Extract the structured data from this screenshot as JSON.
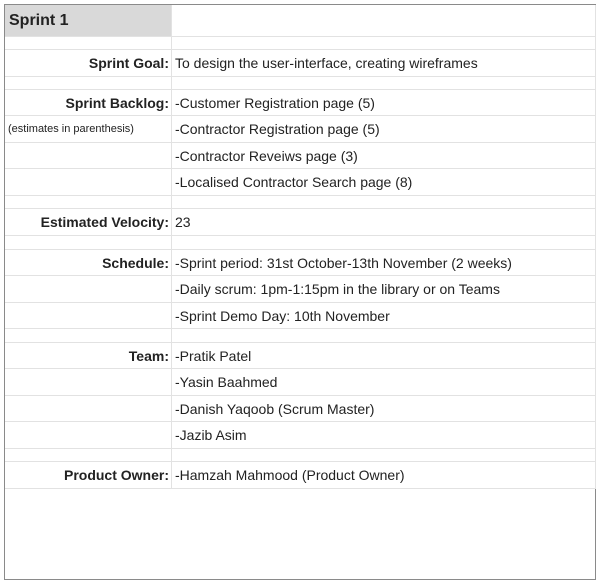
{
  "title": "Sprint 1",
  "sprint_goal": {
    "label": "Sprint Goal:",
    "value": "To design the user-interface, creating wireframes"
  },
  "sprint_backlog": {
    "label": "Sprint Backlog:",
    "note": "(estimates in parenthesis)",
    "items": [
      "-Customer Registration page (5)",
      "-Contractor Registration page (5)",
      "-Contractor Reveiws page (3)",
      "-Localised Contractor Search page (8)"
    ]
  },
  "estimated_velocity": {
    "label": "Estimated Velocity:",
    "value": "23"
  },
  "schedule": {
    "label": "Schedule:",
    "items": [
      "-Sprint period: 31st October-13th November (2 weeks)",
      "-Daily scrum: 1pm-1:15pm in the library or on Teams",
      "-Sprint Demo Day: 10th November"
    ]
  },
  "team": {
    "label": "Team:",
    "members": [
      "-Pratik Patel",
      "-Yasin Baahmed",
      "-Danish Yaqoob (Scrum Master)",
      "-Jazib Asim"
    ]
  },
  "product_owner": {
    "label": "Product Owner:",
    "value": "-Hamzah Mahmood (Product Owner)"
  }
}
